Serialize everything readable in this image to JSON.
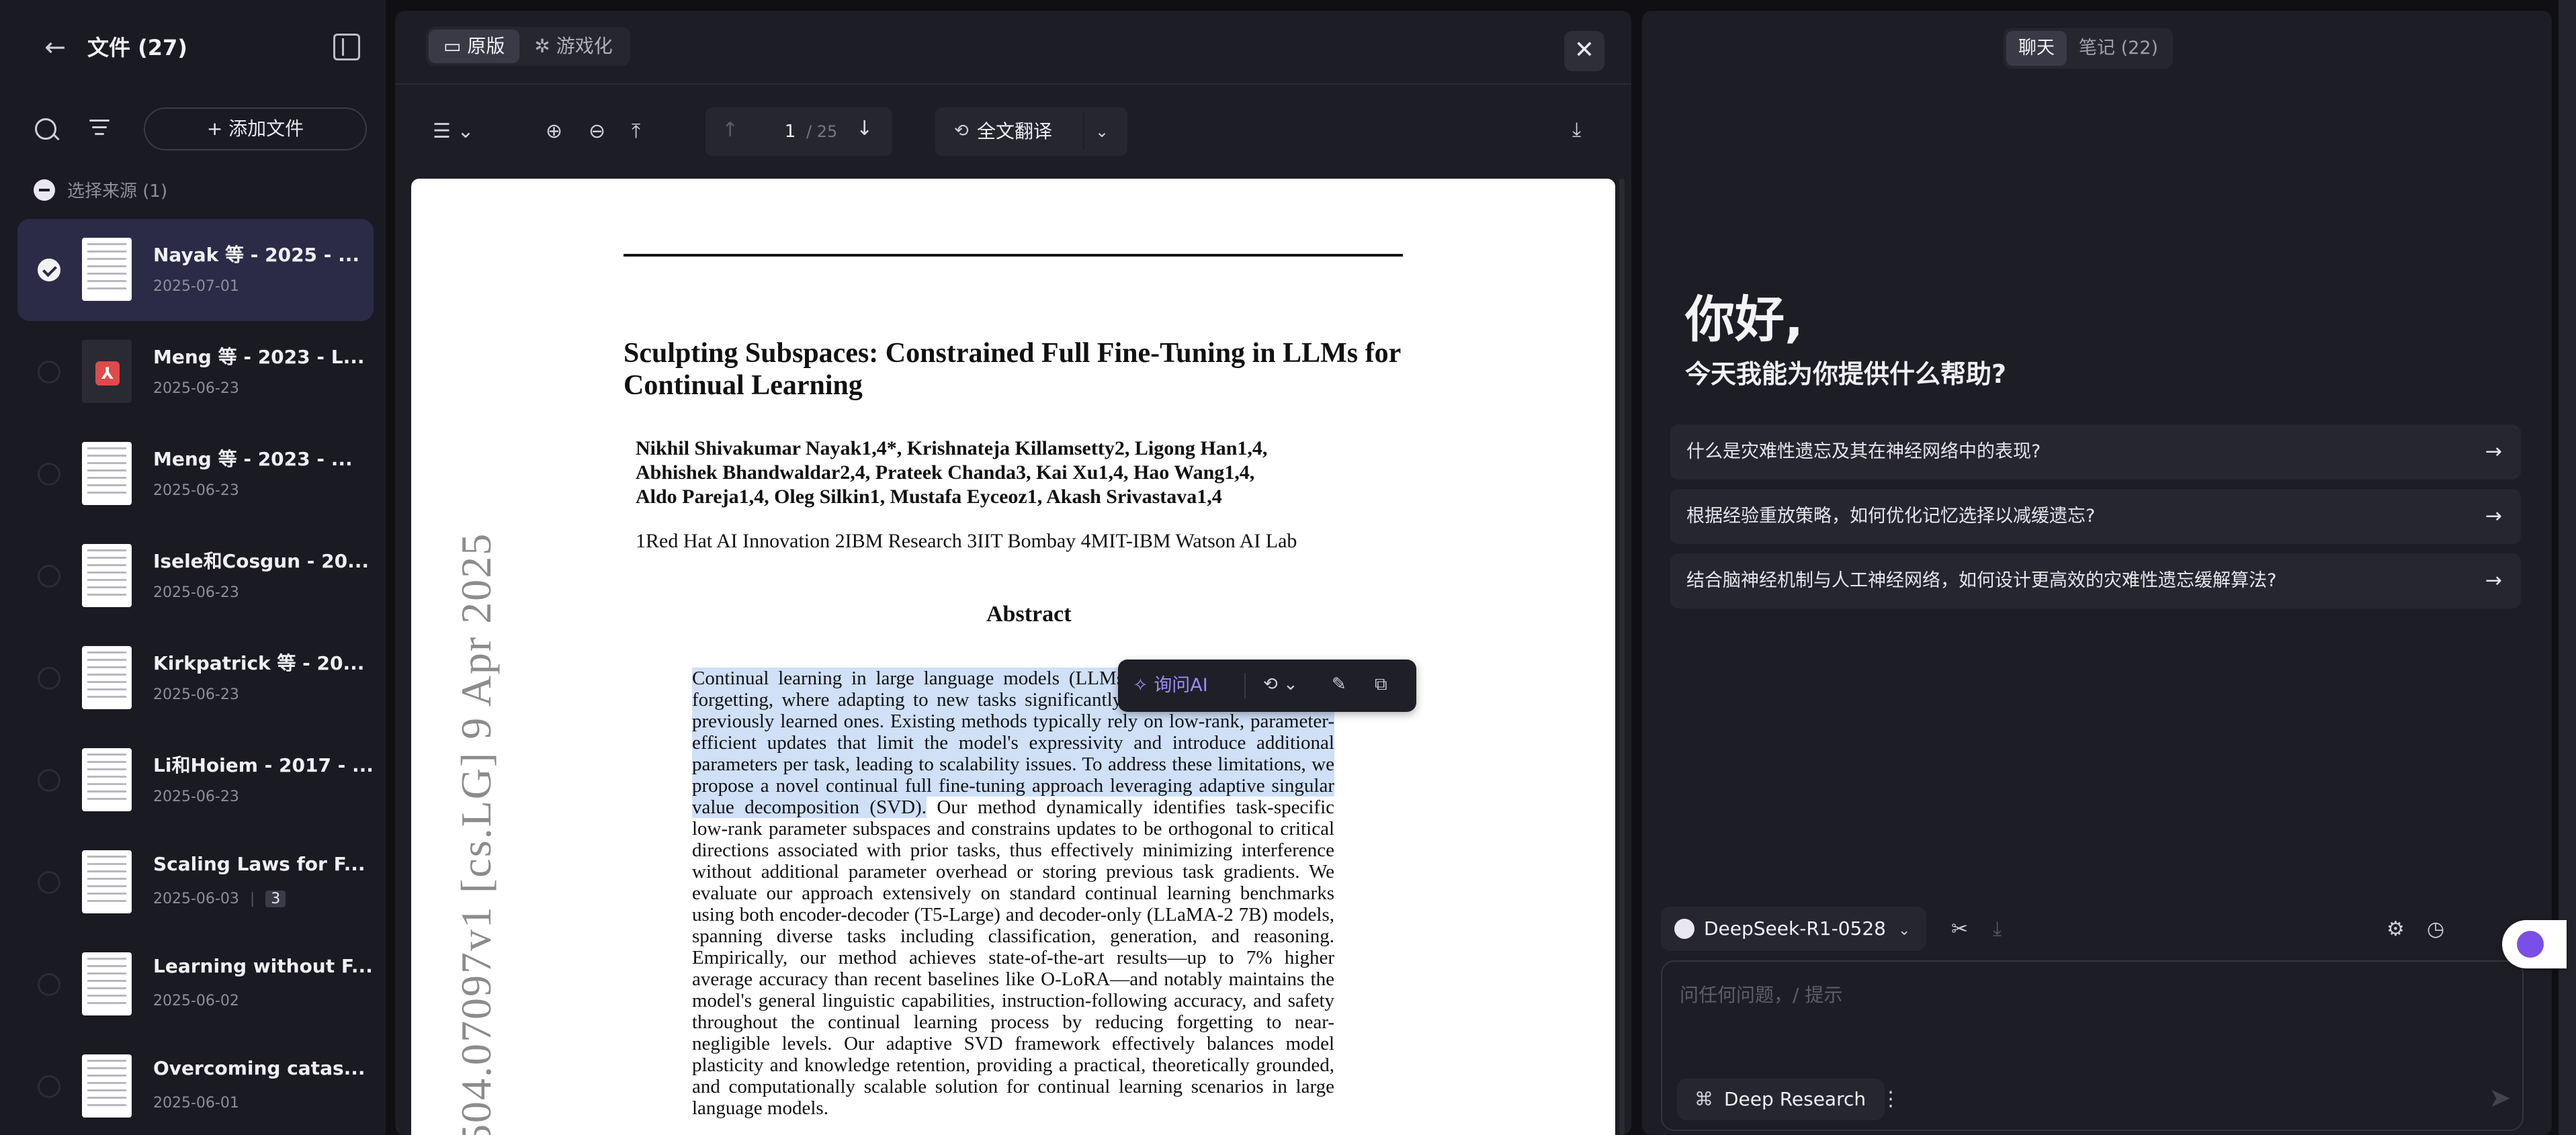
{
  "sidebar": {
    "title": "文件 (27)",
    "add_file_label": "+ 添加文件",
    "select_source_label": "选择来源 (1)",
    "files": [
      {
        "name": "Nayak 等 - 2025 - ...",
        "date": "2025-07-01",
        "active": true,
        "type": "thumb"
      },
      {
        "name": "Meng 等 - 2023 - L...",
        "date": "2025-06-23",
        "active": false,
        "type": "pdf"
      },
      {
        "name": "Meng 等 - 2023 - ...",
        "date": "2025-06-23",
        "active": false,
        "type": "thumb"
      },
      {
        "name": "Isele和Cosgun - 20...",
        "date": "2025-06-23",
        "active": false,
        "type": "thumb"
      },
      {
        "name": "Kirkpatrick 等 - 20...",
        "date": "2025-06-23",
        "active": false,
        "type": "thumb"
      },
      {
        "name": "Li和Hoiem - 2017 - ...",
        "date": "2025-06-23",
        "active": false,
        "type": "thumb"
      },
      {
        "name": "Scaling Laws for F...",
        "date": "2025-06-03",
        "count": "3",
        "active": false,
        "type": "thumb"
      },
      {
        "name": "Learning without F...",
        "date": "2025-06-02",
        "active": false,
        "type": "thumb"
      },
      {
        "name": "Overcoming catas...",
        "date": "2025-06-01",
        "active": false,
        "type": "thumb"
      }
    ]
  },
  "viewer": {
    "tabs": [
      "原版",
      "游戏化"
    ],
    "page_current": "1",
    "page_total": "/ 25",
    "translate_label": "全文翻译",
    "paper": {
      "title": "Sculpting Subspaces: Constrained Full Fine-Tuning in LLMs for Continual Learning",
      "authors_line1": "Nikhil Shivakumar Nayak1,4*, Krishnateja Killamsetty2, Ligong Han1,4,",
      "authors_line2": "Abhishek Bhandwaldar2,4, Prateek Chanda3, Kai Xu1,4, Hao Wang1,4,",
      "authors_line3": "Aldo Pareja1,4, Oleg Silkin1, Mustafa Eyceoz1, Akash Srivastava1,4",
      "affiliations": "1Red Hat AI Innovation   2IBM Research   3IIT Bombay   4MIT-IBM Watson AI Lab",
      "abstract_title": "Abstract",
      "abstract_highlighted": "Continual learning in large language models (LLMs) is prone to catastrophic forgetting, where adapting to new tasks significantly degrades performance on previously learned ones. Existing methods typically rely on low-rank, parameter-efficient updates that limit the model's expressivity and introduce additional parameters per task, leading to scalability issues. To address these limitations, we propose a novel continual full fine-tuning approach leveraging adaptive singular value decomposition (SVD).",
      "abstract_rest": " Our method dynamically identifies task-specific low-rank parameter subspaces and constrains updates to be orthogonal to critical directions associated with prior tasks, thus effectively minimizing interference without additional parameter overhead or storing previous task gradients. We evaluate our approach extensively on standard continual learning benchmarks using both encoder-decoder (T5-Large) and decoder-only (LLaMA-2 7B) models, spanning diverse tasks including classification, generation, and reasoning. Empirically, our method achieves state-of-the-art results—up to 7% higher average accuracy than recent baselines like O-LoRA—and notably maintains the model's general linguistic capabilities, instruction-following accuracy, and safety throughout the continual learning process by reducing forgetting to near-negligible levels. Our adaptive SVD framework effectively balances model plasticity and knowledge retention, providing a practical, theoretically grounded, and computationally scalable solution for continual learning scenarios in large language models.",
      "side_id": "504.07097v1  [cs.LG]  9 Apr 2025"
    },
    "ask_ai_label": "询问AI"
  },
  "chat": {
    "tabs": [
      "聊天",
      "笔记 (22)"
    ],
    "greeting": "你好,",
    "greeting_sub": "今天我能为你提供什么帮助?",
    "suggestions": [
      "什么是灾难性遗忘及其在神经网络中的表现?",
      "根据经验重放策略，如何优化记忆选择以减缓遗忘?",
      "结合脑神经机制与人工神经网络，如何设计更高效的灾难性遗忘缓解算法?"
    ],
    "model_name": "DeepSeek-R1-0528",
    "input_placeholder": "问任何问题，/ 提示",
    "deep_research_label": "Deep Research"
  }
}
